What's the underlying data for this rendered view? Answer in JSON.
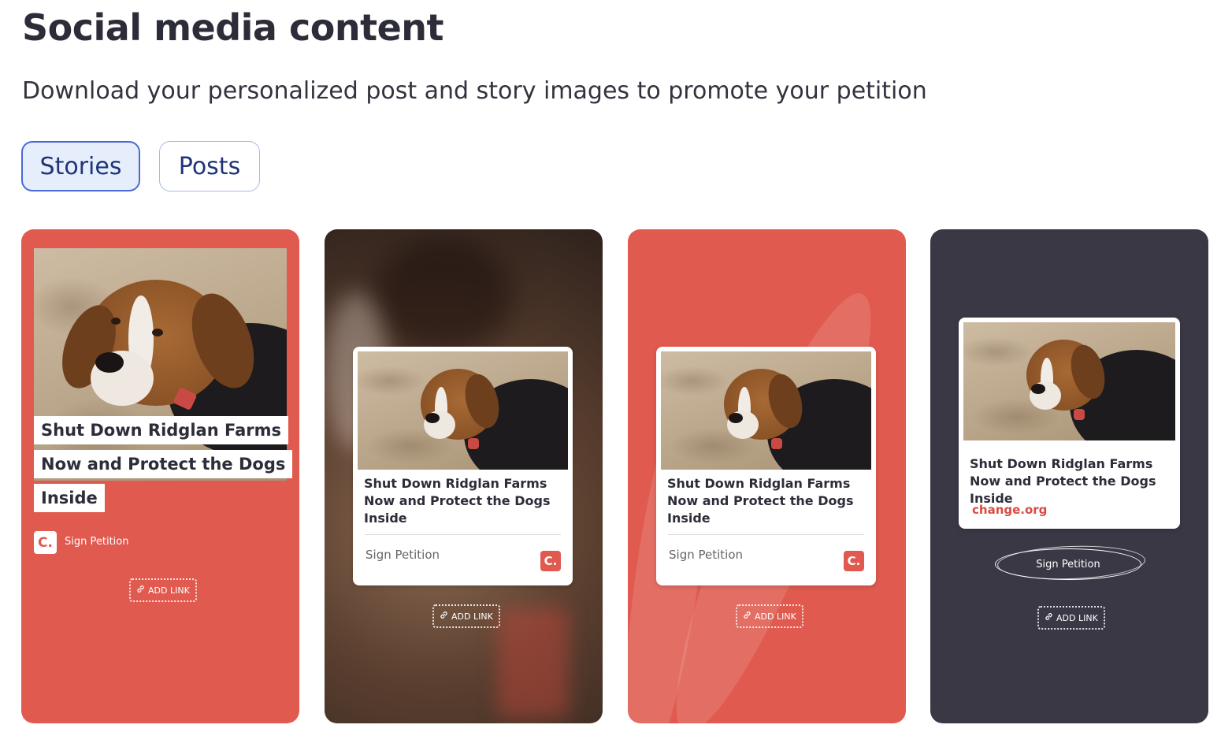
{
  "header": {
    "title": "Social media content",
    "subtitle": "Download your personalized post and story images to promote your petition"
  },
  "tabs": [
    {
      "label": "Stories",
      "selected": true
    },
    {
      "label": "Posts",
      "selected": false
    }
  ],
  "stories": [
    {
      "style": "red-headline",
      "headline_lines": [
        "Shut Down Ridglan Farms",
        "Now and Protect the Dogs",
        "Inside"
      ],
      "logo_text": "C.",
      "sign_label": "Sign Petition",
      "add_link_label": "ADD LINK"
    },
    {
      "style": "blurred-photo-card",
      "card_title": "Shut Down Ridglan Farms Now and Protect the Dogs Inside",
      "sign_label": "Sign Petition",
      "logo_text": "C.",
      "add_link_label": "ADD LINK"
    },
    {
      "style": "red-card",
      "card_title": "Shut Down Ridglan Farms Now and Protect the Dogs Inside",
      "sign_label": "Sign Petition",
      "logo_text": "C.",
      "add_link_label": "ADD LINK"
    },
    {
      "style": "dark-card",
      "card_title": "Shut Down Ridglan Farms Now and Protect the Dogs Inside",
      "domain": "change.org",
      "sign_label": "Sign Petition",
      "add_link_label": "ADD LINK"
    }
  ],
  "colors": {
    "brand_red": "#e05a4f",
    "dark_bg": "#3a3845",
    "tab_active_bg": "#e6eefc",
    "tab_border": "#4a6ad6"
  },
  "icons": {
    "link": "link-icon",
    "logo": "change-logo-icon",
    "photo": "dog-photo"
  }
}
